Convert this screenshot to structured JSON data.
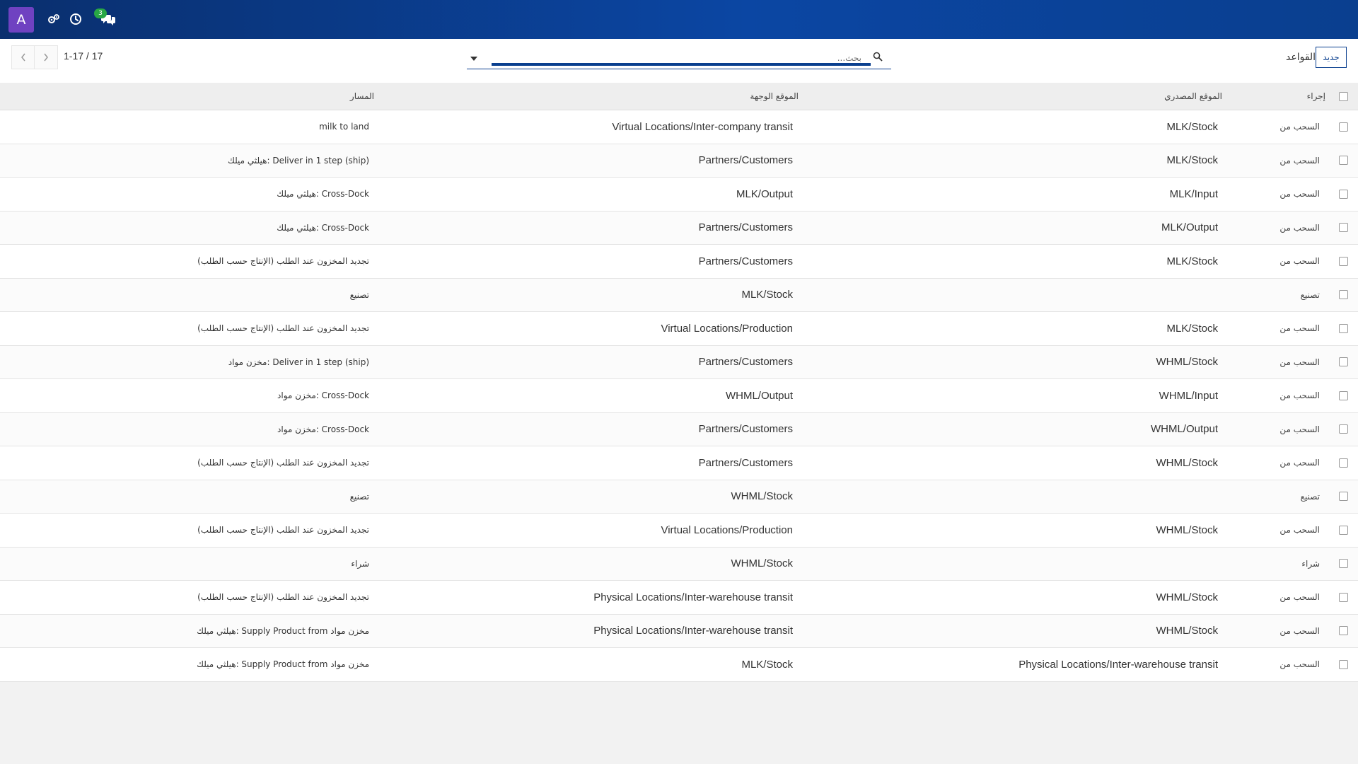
{
  "navbar": {
    "avatar_letter": "A",
    "badge_count": "3"
  },
  "control": {
    "pager": "1-17 / 17",
    "search_placeholder": "بحث...",
    "title": "القواعد",
    "new_button": "جديد"
  },
  "table": {
    "headers": {
      "action": "إجراء",
      "source": "الموقع المصدري",
      "destination": "الموقع الوجهة",
      "route": "المسار"
    },
    "rows": [
      {
        "action": "السحب من",
        "source": "MLK/Stock",
        "destination": "Virtual Locations/Inter-company transit",
        "route": "milk to land"
      },
      {
        "action": "السحب من",
        "source": "MLK/Stock",
        "destination": "Partners/Customers",
        "route": "هيلثي ميلك: Deliver in 1 step (ship)"
      },
      {
        "action": "السحب من",
        "source": "MLK/Input",
        "destination": "MLK/Output",
        "route": "هيلثي ميلك: Cross-Dock"
      },
      {
        "action": "السحب من",
        "source": "MLK/Output",
        "destination": "Partners/Customers",
        "route": "هيلثي ميلك: Cross-Dock"
      },
      {
        "action": "السحب من",
        "source": "MLK/Stock",
        "destination": "Partners/Customers",
        "route": "تجديد المخزون عند الطلب (الإنتاج حسب الطلب)"
      },
      {
        "action": "تصنيع",
        "source": "",
        "destination": "MLK/Stock",
        "route": "تصنيع"
      },
      {
        "action": "السحب من",
        "source": "MLK/Stock",
        "destination": "Virtual Locations/Production",
        "route": "تجديد المخزون عند الطلب (الإنتاج حسب الطلب)"
      },
      {
        "action": "السحب من",
        "source": "WHML/Stock",
        "destination": "Partners/Customers",
        "route": "مخزن مواد: Deliver in 1 step (ship)"
      },
      {
        "action": "السحب من",
        "source": "WHML/Input",
        "destination": "WHML/Output",
        "route": "مخزن مواد: Cross-Dock"
      },
      {
        "action": "السحب من",
        "source": "WHML/Output",
        "destination": "Partners/Customers",
        "route": "مخزن مواد: Cross-Dock"
      },
      {
        "action": "السحب من",
        "source": "WHML/Stock",
        "destination": "Partners/Customers",
        "route": "تجديد المخزون عند الطلب (الإنتاج حسب الطلب)"
      },
      {
        "action": "تصنيع",
        "source": "",
        "destination": "WHML/Stock",
        "route": "تصنيع"
      },
      {
        "action": "السحب من",
        "source": "WHML/Stock",
        "destination": "Virtual Locations/Production",
        "route": "تجديد المخزون عند الطلب (الإنتاج حسب الطلب)"
      },
      {
        "action": "شراء",
        "source": "",
        "destination": "WHML/Stock",
        "route": "شراء"
      },
      {
        "action": "السحب من",
        "source": "WHML/Stock",
        "destination": "Physical Locations/Inter-warehouse transit",
        "route": "تجديد المخزون عند الطلب (الإنتاج حسب الطلب)"
      },
      {
        "action": "السحب من",
        "source": "WHML/Stock",
        "destination": "Physical Locations/Inter-warehouse transit",
        "route": "هيلثي ميلك: Supply Product from مخزن مواد"
      },
      {
        "action": "السحب من",
        "source": "Physical Locations/Inter-warehouse transit",
        "destination": "MLK/Stock",
        "route": "هيلثي ميلك: Supply Product from مخزن مواد"
      }
    ]
  },
  "icons": {
    "settings": "gears-icon",
    "activity": "clock-icon",
    "messages": "chat-icon",
    "search": "search-icon",
    "search_toggle": "caret-down-icon",
    "prev": "chevron-left-icon",
    "next": "chevron-right-icon"
  },
  "colors": {
    "navbar": "#0b46a3",
    "avatar": "#6f42c1",
    "badge": "#28a745",
    "accent": "#0a3f8f"
  }
}
